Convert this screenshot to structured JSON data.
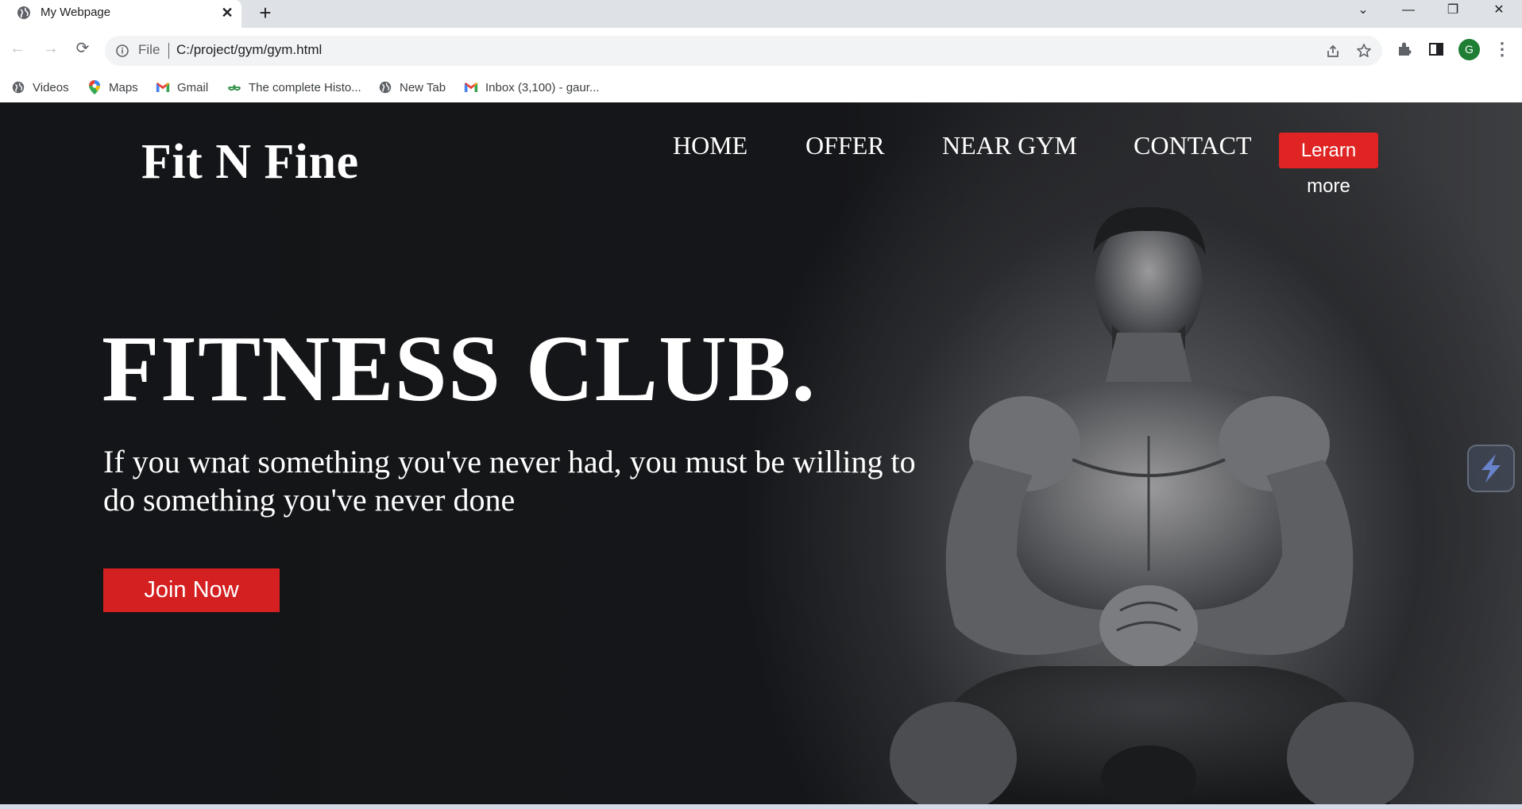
{
  "browser": {
    "tab": {
      "title": "My Webpage",
      "close_glyph": "✕"
    },
    "new_tab_glyph": "+",
    "window_controls": {
      "tab_search": "⌄",
      "minimize": "—",
      "restore": "❐",
      "close": "✕"
    },
    "nav": {
      "back": "←",
      "forward": "→",
      "reload": "⟳"
    },
    "omnibox": {
      "scheme_label": "File",
      "url": "C:/project/gym/gym.html"
    },
    "profile_initial": "G",
    "menu_glyph": "⋮",
    "bookmarks": [
      {
        "label": "Videos",
        "icon": "globe-icon"
      },
      {
        "label": "Maps",
        "icon": "maps-pin-icon"
      },
      {
        "label": "Gmail",
        "icon": "gmail-icon"
      },
      {
        "label": "The complete Histo...",
        "icon": "gfg-icon"
      },
      {
        "label": "New Tab",
        "icon": "globe-icon"
      },
      {
        "label": "Inbox (3,100) - gaur...",
        "icon": "gmail-icon"
      }
    ]
  },
  "site": {
    "logo": "Fit N Fine",
    "nav": [
      "HOME",
      "OFFER",
      "NEAR GYM",
      "CONTACT"
    ],
    "cta_header": "Lerarn more",
    "hero": {
      "title": "FITNESS CLUB.",
      "subtitle": "If you wnat something you've never had, you must be willing to do something you've never done",
      "cta": "Join Now"
    }
  },
  "colors": {
    "page_bg": "#151619",
    "accent_red": "#e02323",
    "join_red": "#d42021",
    "text_white": "#ffffff",
    "chrome_bg": "#dee1e6",
    "profile_green": "#1e7e34"
  }
}
